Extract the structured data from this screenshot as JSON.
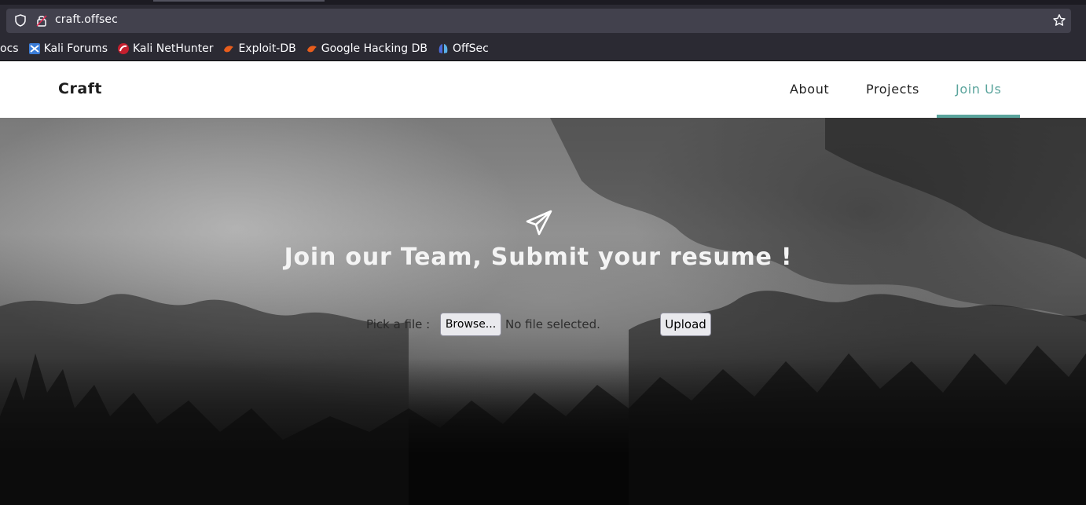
{
  "browser": {
    "url": "craft.offsec",
    "bookmarks": [
      {
        "label": "ocs",
        "icon": "docs-icon"
      },
      {
        "label": "Kali Forums",
        "icon": "kali-forums-icon"
      },
      {
        "label": "Kali NetHunter",
        "icon": "kali-nethunter-icon"
      },
      {
        "label": "Exploit-DB",
        "icon": "exploit-db-icon"
      },
      {
        "label": "Google Hacking DB",
        "icon": "google-hacking-db-icon"
      },
      {
        "label": "OffSec",
        "icon": "offsec-icon"
      }
    ]
  },
  "site": {
    "brand": "Craft",
    "nav": [
      {
        "label": "About",
        "active": false
      },
      {
        "label": "Projects",
        "active": false
      },
      {
        "label": "Join Us",
        "active": true
      }
    ],
    "accent_color": "#5aa49c"
  },
  "hero": {
    "icon": "paper-plane-icon",
    "title": "Join our Team, Submit your resume !",
    "form": {
      "pick_label": "Pick a file :",
      "browse_label": "Browse...",
      "file_status": "No file selected.",
      "upload_label": "Upload"
    }
  }
}
